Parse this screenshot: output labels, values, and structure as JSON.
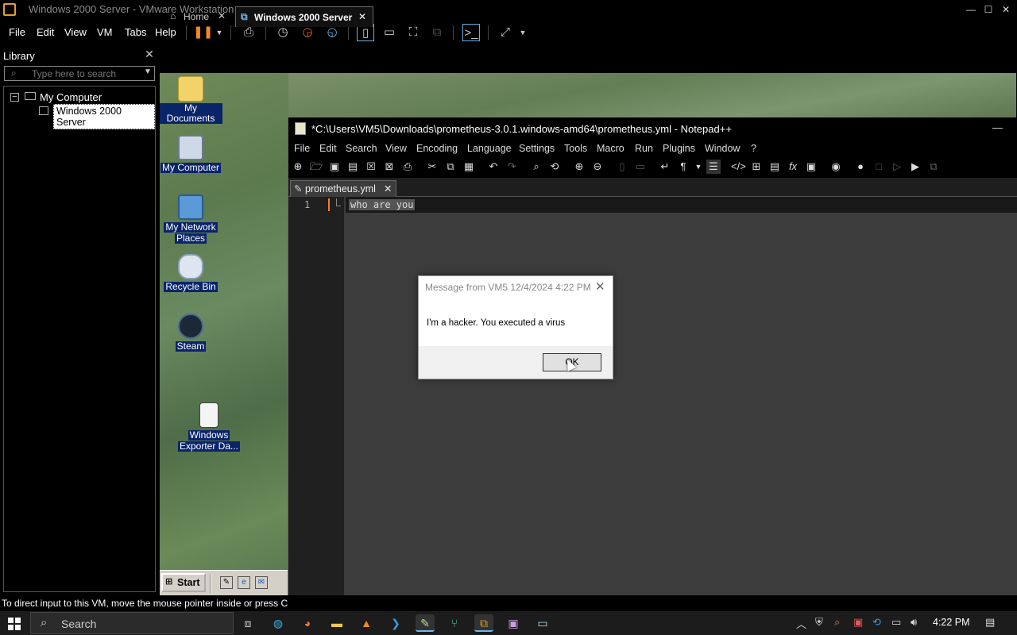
{
  "vmware": {
    "title": "Windows 2000 Server - VMware Workstation",
    "menu": [
      "File",
      "Edit",
      "View",
      "VM",
      "Tabs",
      "Help"
    ],
    "window_controls": [
      "minimize-icon",
      "maximize-icon",
      "close-icon"
    ],
    "status_text": "To direct input to this VM, move the mouse pointer inside or press Ctrl+G."
  },
  "library": {
    "title": "Library",
    "close": "✕",
    "search_placeholder": "Type here to search",
    "tree_root": "My Computer",
    "tree_child": "Windows 2000 Server"
  },
  "tabs": [
    {
      "label": "Home",
      "close": "✕"
    },
    {
      "label": "Windows 2000 Server",
      "close": "✕"
    }
  ],
  "desktop": {
    "icons": [
      {
        "label": "My Documents",
        "icon": "folder-icon"
      },
      {
        "label": "My Computer",
        "icon": "computer-icon"
      },
      {
        "label_line1": "My Network",
        "label_line2": "Places",
        "icon": "network-icon"
      },
      {
        "label": "Recycle Bin",
        "icon": "recycle-bin-icon"
      },
      {
        "label": "Steam",
        "icon": "steam-icon"
      },
      {
        "label_line1": "Windows",
        "label_line2": "Exporter Da...",
        "icon": "file-icon"
      }
    ],
    "start_label": "Start"
  },
  "notepadpp": {
    "title": "*C:\\Users\\VM5\\Downloads\\prometheus-3.0.1.windows-amd64\\prometheus.yml - Notepad++",
    "menu": [
      "File",
      "Edit",
      "Search",
      "View",
      "Encoding",
      "Language",
      "Settings",
      "Tools",
      "Macro",
      "Run",
      "Plugins",
      "Window",
      "?"
    ],
    "tab_label": "prometheus.yml",
    "tab_close": "✕",
    "line_number": "1",
    "line_text": "who are you",
    "minimize": "—"
  },
  "message_box": {
    "title": "Message from VM5 12/4/2024 4:22 PM",
    "close": "✕",
    "text": "I'm a hacker. You executed a virus",
    "ok_label": "OK"
  },
  "taskbar": {
    "search_label": "Search",
    "time": "4:22 PM"
  }
}
